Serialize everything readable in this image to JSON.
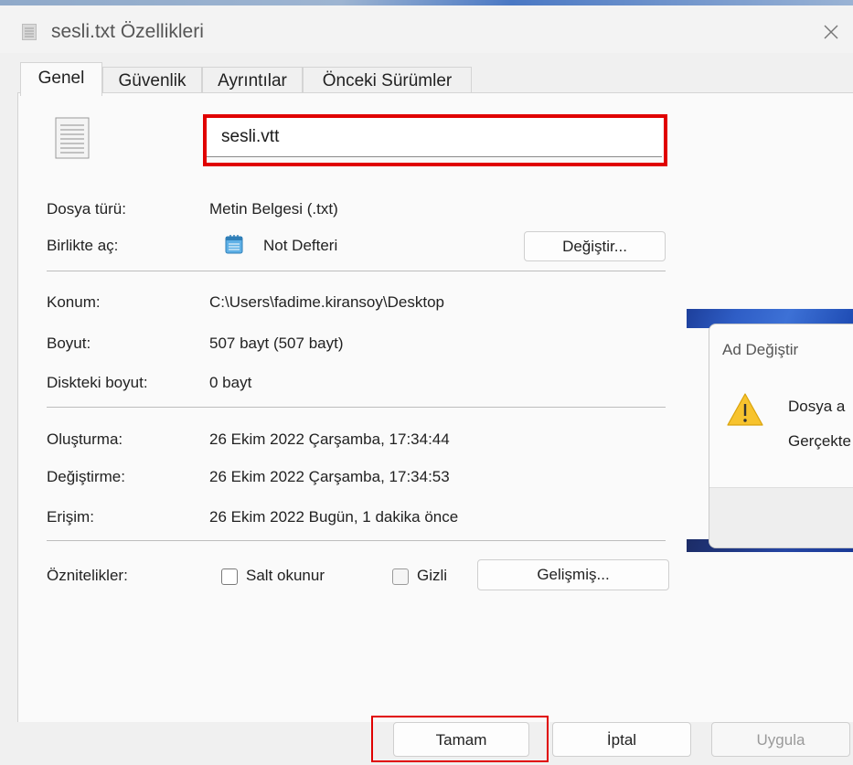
{
  "window": {
    "title": "sesli.txt Özellikleri",
    "close_icon": "close-icon"
  },
  "tabs": [
    {
      "label": "Genel",
      "active": true
    },
    {
      "label": "Güvenlik"
    },
    {
      "label": "Ayrıntılar"
    },
    {
      "label": "Önceki Sürümler"
    }
  ],
  "general": {
    "file_name": "sesli.vtt",
    "file_type_label": "Dosya türü:",
    "file_type_value": "Metin Belgesi (.txt)",
    "opens_with_label": "Birlikte aç:",
    "opens_with_value": "Not Defteri",
    "change_button": "Değiştir...",
    "location_label": "Konum:",
    "location_value": "C:\\Users\\fadime.kiransoy\\Desktop",
    "size_label": "Boyut:",
    "size_value": "507 bayt (507 bayt)",
    "size_on_disk_label": "Diskteki boyut:",
    "size_on_disk_value": "0 bayt",
    "created_label": "Oluşturma:",
    "created_value": "26 Ekim 2022 Çarşamba, 17:34:44",
    "modified_label": "Değiştirme:",
    "modified_value": "26 Ekim 2022 Çarşamba, 17:34:53",
    "accessed_label": "Erişim:",
    "accessed_value": "26 Ekim 2022 Bugün, 1 dakika önce",
    "attributes_label": "Öznitelikler:",
    "readonly_label": "Salt okunur",
    "hidden_label": "Gizli",
    "advanced_button": "Gelişmiş..."
  },
  "footer": {
    "ok": "Tamam",
    "cancel": "İptal",
    "apply": "Uygula"
  },
  "rename_dialog": {
    "title": "Ad Değiştir",
    "message_line1": "Dosya a",
    "message_line2": "Gerçekte"
  },
  "colors": {
    "highlight": "#e00000",
    "warning": "#f7c32e"
  }
}
